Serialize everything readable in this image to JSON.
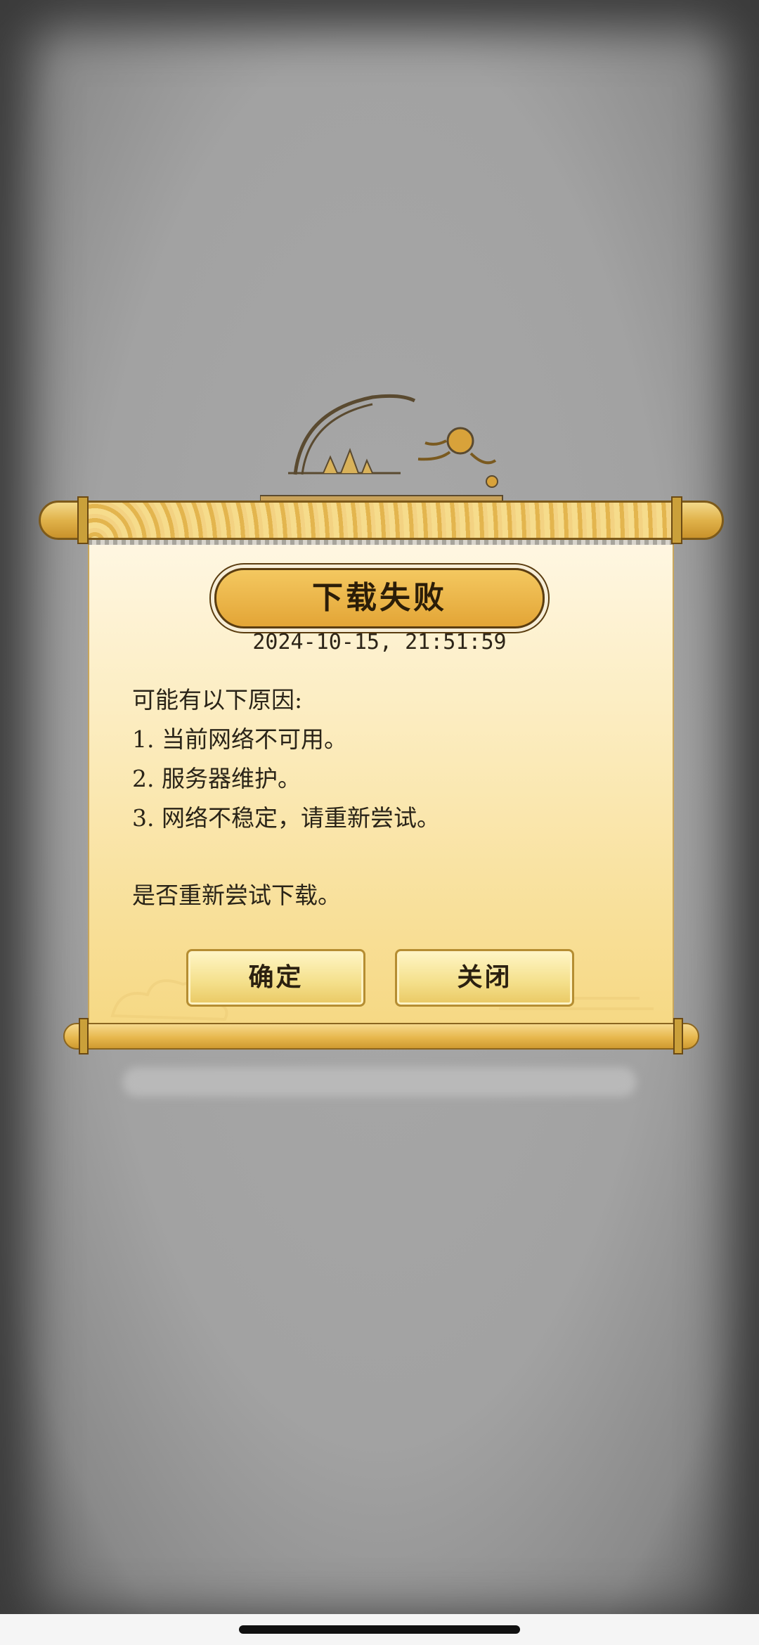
{
  "dialog": {
    "title": "下载失败",
    "timestamp": "2024-10-15, 21:51:59",
    "lines": [
      "可能有以下原因:",
      "1. 当前网络不可用。",
      "2. 服务器维护。",
      "3. 网络不稳定，请重新尝试。",
      "是否重新尝试下载。"
    ],
    "confirm_label": "确定",
    "close_label": "关闭"
  },
  "colors": {
    "gold": "#e3a536",
    "paper": "#fbeab8",
    "ink": "#2a2418"
  }
}
